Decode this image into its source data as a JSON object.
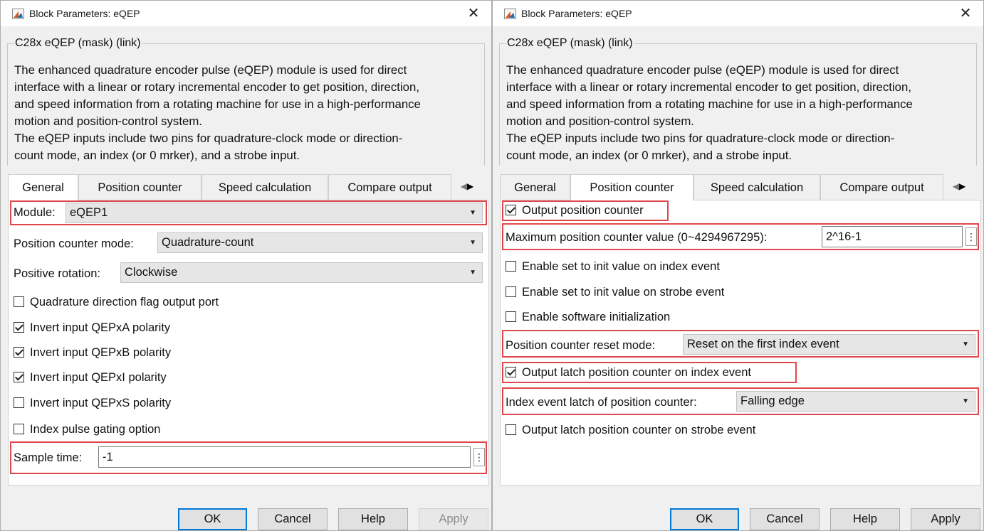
{
  "colors": {
    "highlight": "#e0474c",
    "primary_border": "#0078d7",
    "dialog_bg": "#f0f0f0"
  },
  "left": {
    "title": "Block Parameters: eQEP",
    "close_glyph": "✕",
    "mask_title": "C28x eQEP (mask) (link)",
    "description": [
      "The enhanced quadrature encoder pulse (eQEP) module is used for direct",
      "interface with a linear or rotary incremental encoder to get position, direction,",
      "and speed information from a rotating machine for use in a high-performance",
      "motion and position-control system.",
      "The eQEP inputs include two pins for quadrature-clock mode or direction-",
      "count mode, an index (or 0 mrker), and a strobe input."
    ],
    "tabs": [
      "General",
      "Position counter",
      "Speed calculation",
      "Compare output"
    ],
    "active_tab": "General",
    "module_label": "Module:",
    "module_value": "eQEP1",
    "pos_mode_label": "Position counter mode:",
    "pos_mode_value": "Quadrature-count",
    "pos_rot_label": "Positive rotation:",
    "pos_rot_value": "Clockwise",
    "checkboxes": [
      {
        "label": "Quadrature direction flag output port",
        "checked": false
      },
      {
        "label": "Invert input QEPxA polarity",
        "checked": true
      },
      {
        "label": "Invert input QEPxB polarity",
        "checked": true
      },
      {
        "label": "Invert input QEPxI polarity",
        "checked": true
      },
      {
        "label": "Invert input QEPxS polarity",
        "checked": false
      },
      {
        "label": "Index pulse gating option",
        "checked": false
      }
    ],
    "sample_label": "Sample time:",
    "sample_value": "-1",
    "buttons": {
      "ok": "OK",
      "cancel": "Cancel",
      "help": "Help",
      "apply": "Apply"
    },
    "apply_enabled": false
  },
  "right": {
    "title": "Block Parameters: eQEP",
    "close_glyph": "✕",
    "mask_title": "C28x eQEP (mask) (link)",
    "description": [
      "The enhanced quadrature encoder pulse (eQEP) module is used for direct",
      "interface with a linear or rotary incremental encoder to get position, direction,",
      "and speed information from a rotating machine for use in a high-performance",
      "motion and position-control system.",
      "The eQEP inputs include two pins for quadrature-clock mode or direction-",
      "count mode, an index (or 0 mrker), and a strobe input."
    ],
    "tabs": [
      "General",
      "Position counter",
      "Speed calculation",
      "Compare output"
    ],
    "active_tab": "Position counter",
    "output_pos_counter": {
      "label": "Output position counter",
      "checked": true
    },
    "max_label": "Maximum position counter value (0~4294967295):",
    "max_value": "2^16-1",
    "enable_index": {
      "label": "Enable set to init value on index event",
      "checked": false
    },
    "enable_strobe": {
      "label": "Enable set to init value on strobe event",
      "checked": false
    },
    "enable_software": {
      "label": "Enable software initialization",
      "checked": false
    },
    "reset_mode_label": "Position counter reset mode:",
    "reset_mode_value": "Reset on the first index event",
    "latch_index": {
      "label": "Output latch position counter on index event",
      "checked": true
    },
    "index_latch_label": "Index event latch of position counter:",
    "index_latch_value": "Falling edge",
    "latch_strobe": {
      "label": "Output latch position counter on strobe event",
      "checked": false
    },
    "buttons": {
      "ok": "OK",
      "cancel": "Cancel",
      "help": "Help",
      "apply": "Apply"
    },
    "apply_enabled": true
  }
}
